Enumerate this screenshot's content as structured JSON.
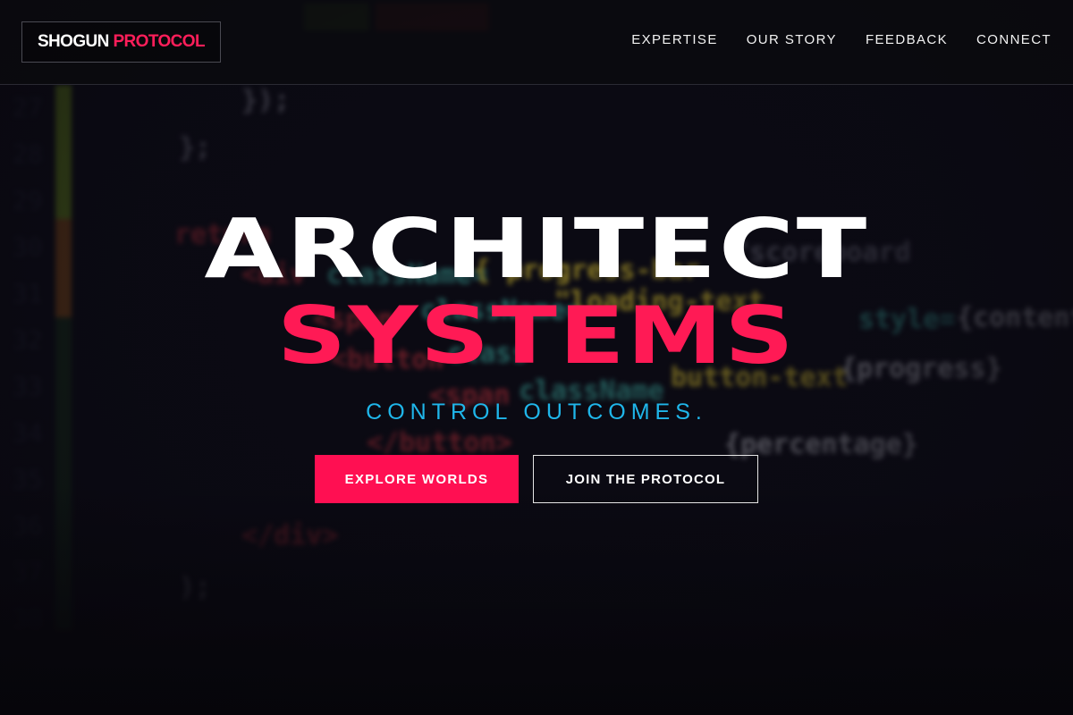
{
  "header": {
    "logo": {
      "part1": "SHOGUN",
      "part2": "PROTOCOL"
    },
    "nav": [
      {
        "label": "EXPERTISE"
      },
      {
        "label": "OUR STORY"
      },
      {
        "label": "FEEDBACK"
      },
      {
        "label": "CONNECT"
      }
    ]
  },
  "hero": {
    "title_line1": "ARCHITECT",
    "title_line2": "SYSTEMS",
    "tagline": "CONTROL OUTCOMES.",
    "primary_button": "EXPLORE WORLDS",
    "secondary_button": "JOIN THE PROTOCOL"
  },
  "colors": {
    "accent": "#ff1a55",
    "tagline": "#1fb6ea",
    "background": "#0c0b14"
  }
}
